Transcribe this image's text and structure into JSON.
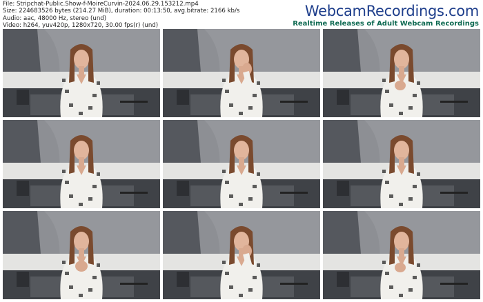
{
  "header": {
    "file_line": "File: Stripchat-Public.Show-f-MoireCurvin-2024.06.29.153212.mp4",
    "size_line": "Size: 224683526 bytes (214.27 MiB), duration: 00:13:50, avg.bitrate: 2166 kb/s",
    "audio_line": "Audio: aac, 48000 Hz, stereo (und)",
    "video_line": "Video: h264, yuv420p, 1280x720, 30.00 fps(r) (und)"
  },
  "brand": {
    "name": "WebcamRecordings.com",
    "tagline": "Realtime Releases of Adult Webcam Recordings"
  },
  "thumbnails": [
    {
      "pose": "center"
    },
    {
      "pose": "hand-chin"
    },
    {
      "pose": "hand-chest"
    },
    {
      "pose": "center"
    },
    {
      "pose": "center"
    },
    {
      "pose": "center"
    },
    {
      "pose": "hands-chest"
    },
    {
      "pose": "hand-chin"
    },
    {
      "pose": "hand-chest"
    }
  ],
  "colors": {
    "brand_blue": "#1f3f8c",
    "brand_green": "#0f6a52",
    "wall": "#8d8f94",
    "robe": "#f1f0ec",
    "hair": "#7a4a2e"
  }
}
